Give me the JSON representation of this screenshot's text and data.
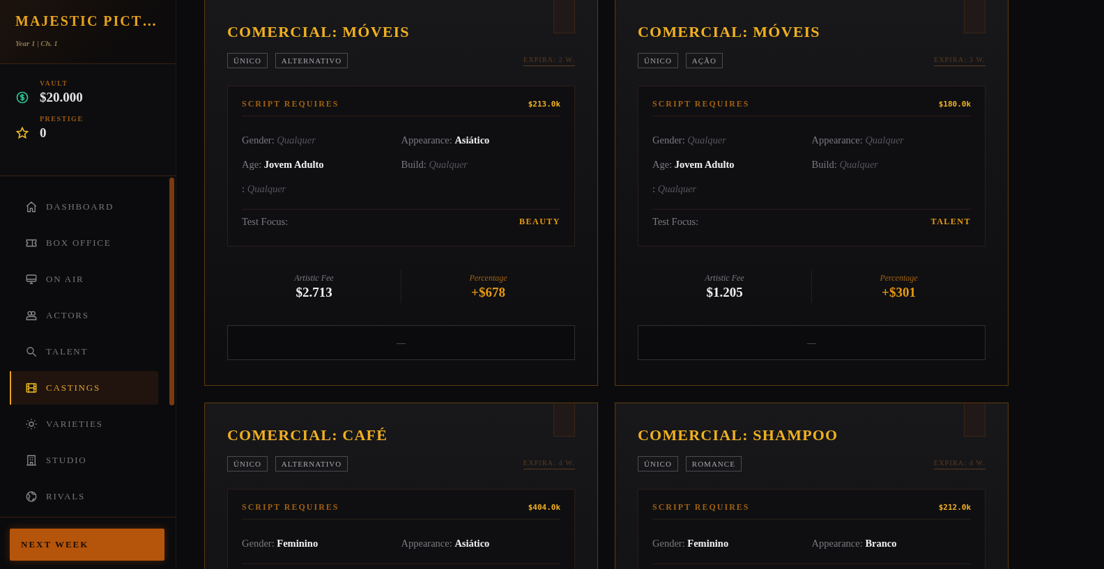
{
  "sidebar": {
    "title": "MAJESTIC PICT…",
    "subtitle": "Year 1 | Ch. 1",
    "stats": [
      {
        "kind": "money",
        "label": "VAULT",
        "value": "$20.000"
      },
      {
        "kind": "star",
        "label": "PRESTIGE",
        "value": "0"
      }
    ],
    "nav": [
      {
        "label": "DASHBOARD",
        "selected": false
      },
      {
        "label": "BOX OFFICE",
        "selected": false
      },
      {
        "label": "ON AIR",
        "selected": false
      },
      {
        "label": "ACTORS",
        "selected": false
      },
      {
        "label": "TALENT",
        "selected": false
      },
      {
        "label": "CASTINGS",
        "selected": true
      },
      {
        "label": "VARIETIES",
        "selected": false
      },
      {
        "label": "STUDIO",
        "selected": false
      },
      {
        "label": "RIVALS",
        "selected": false
      }
    ],
    "next_button": "NEXT WEEK"
  },
  "castings": [
    {
      "title": "COMERCIAL: MÓVEIS",
      "tags": [
        "ÚNICO",
        "ALTERNATIVO"
      ],
      "expires": "EXPIRA: 2 W.",
      "requires_label": "SCRIPT REQUIRES",
      "budget": "$213.0k",
      "fields": [
        {
          "label": "Gender:",
          "value": "Qualquer",
          "specified": false
        },
        {
          "label": "Appearance:",
          "value": "Asiático",
          "specified": true
        },
        {
          "label": "Age:",
          "value": "Jovem Adulto",
          "specified": true
        },
        {
          "label": "Build:",
          "value": "Qualquer",
          "specified": false
        },
        {
          "label": ":",
          "value": "Qualquer",
          "specified": false
        }
      ],
      "focus_label": "Test Focus:",
      "focus": "BEAUTY",
      "fee_label": "Artistic Fee",
      "fee": "$2.713",
      "pct_label": "Percentage",
      "pct": "+$678",
      "action": "—"
    },
    {
      "title": "COMERCIAL: MÓVEIS",
      "tags": [
        "ÚNICO",
        "AÇÃO"
      ],
      "expires": "EXPIRA: 3 W.",
      "requires_label": "SCRIPT REQUIRES",
      "budget": "$180.0k",
      "fields": [
        {
          "label": "Gender:",
          "value": "Qualquer",
          "specified": false
        },
        {
          "label": "Appearance:",
          "value": "Qualquer",
          "specified": false
        },
        {
          "label": "Age:",
          "value": "Jovem Adulto",
          "specified": true
        },
        {
          "label": "Build:",
          "value": "Qualquer",
          "specified": false
        },
        {
          "label": ":",
          "value": "Qualquer",
          "specified": false
        }
      ],
      "focus_label": "Test Focus:",
      "focus": "TALENT",
      "fee_label": "Artistic Fee",
      "fee": "$1.205",
      "pct_label": "Percentage",
      "pct": "+$301",
      "action": "—"
    },
    {
      "title": "COMERCIAL: CAFÉ",
      "tags": [
        "ÚNICO",
        "ALTERNATIVO"
      ],
      "expires": "EXPIRA: 4 W.",
      "requires_label": "SCRIPT REQUIRES",
      "budget": "$404.0k",
      "fields": [
        {
          "label": "Gender:",
          "value": "Feminino",
          "specified": true
        },
        {
          "label": "Appearance:",
          "value": "Asiático",
          "specified": true
        }
      ]
    },
    {
      "title": "COMERCIAL: SHAMPOO",
      "tags": [
        "ÚNICO",
        "ROMANCE"
      ],
      "expires": "EXPIRA: 4 W.",
      "requires_label": "SCRIPT REQUIRES",
      "budget": "$212.0k",
      "fields": [
        {
          "label": "Gender:",
          "value": "Feminino",
          "specified": true
        },
        {
          "label": "Appearance:",
          "value": "Branco",
          "specified": true
        }
      ]
    }
  ]
}
